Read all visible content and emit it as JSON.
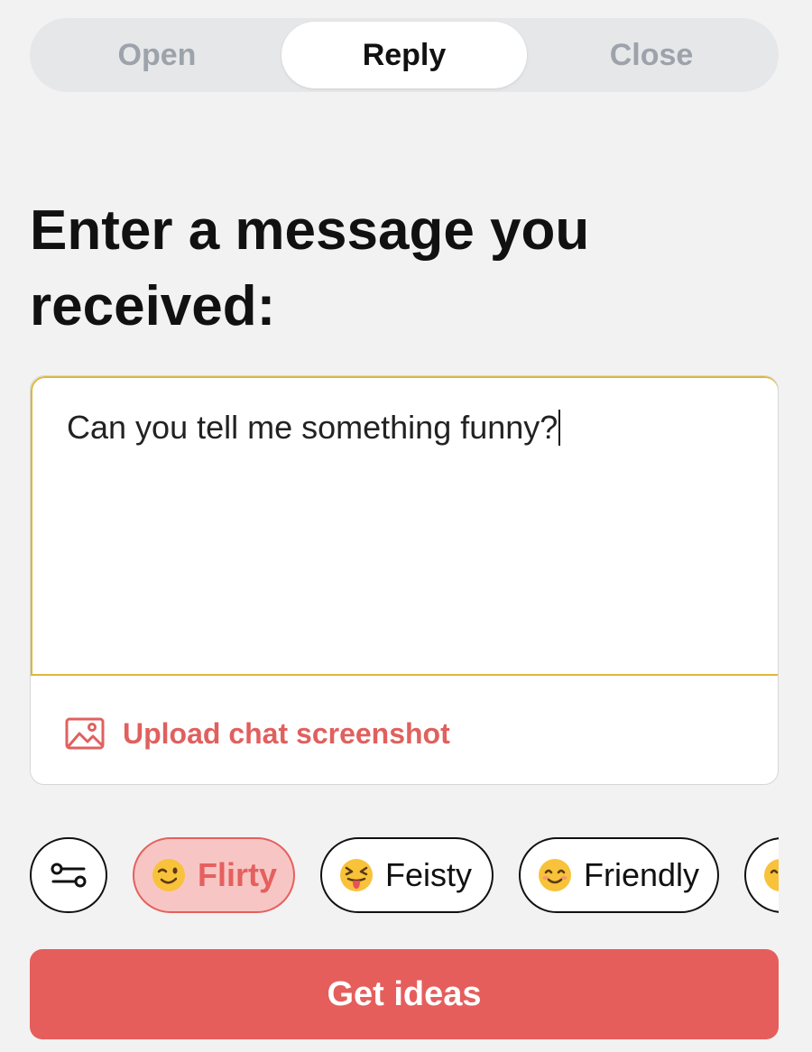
{
  "tabs": [
    {
      "label": "Open",
      "selected": false
    },
    {
      "label": "Reply",
      "selected": true
    },
    {
      "label": "Close",
      "selected": false
    }
  ],
  "heading": "Enter a message you received:",
  "message": {
    "value": "Can you tell me something funny?"
  },
  "upload": {
    "label": "Upload chat screenshot",
    "icon": "image-icon"
  },
  "tones": {
    "filter_icon": "sliders-icon",
    "options": [
      {
        "label": "Flirty",
        "icon": "winking-face-emoji",
        "selected": true
      },
      {
        "label": "Feisty",
        "icon": "tongue-squinting-face-emoji",
        "selected": false
      },
      {
        "label": "Friendly",
        "icon": "smiling-face-emoji",
        "selected": false
      },
      {
        "label": "",
        "icon": "partially-visible-emoji",
        "selected": false
      }
    ]
  },
  "cta": {
    "label": "Get ideas"
  },
  "colors": {
    "accent": "#e55e5c",
    "accent_light": "#f7c6c4",
    "input_border": "#e0b73a",
    "background": "#f2f2f2",
    "muted_tab": "#9ca3ab"
  }
}
